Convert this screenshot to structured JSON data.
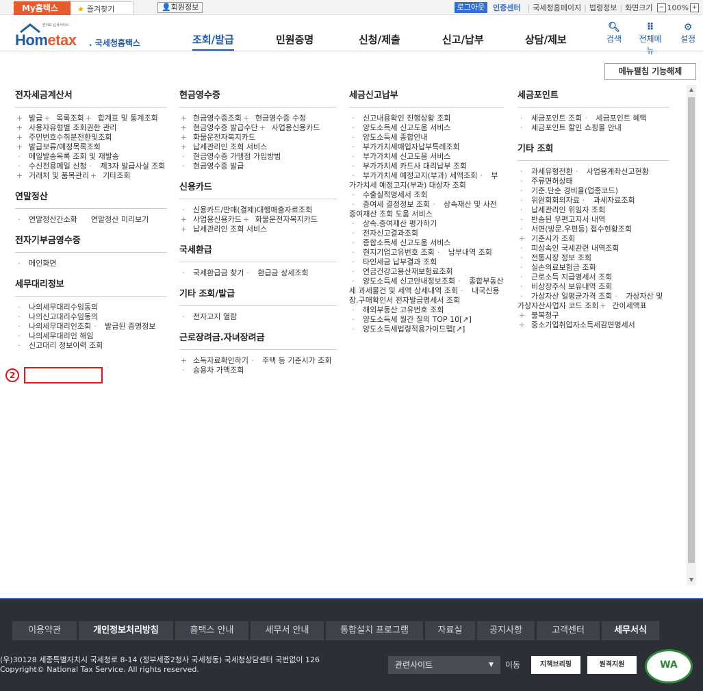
{
  "topbar": {
    "my_tab": "My홈택스",
    "favorites": "즐겨찾기",
    "member_info": "회원정보",
    "logout": "로그아웃",
    "cert_center": "인증센터",
    "nts_home": "국세청홈페이지",
    "law_info": "법령정보",
    "screen_size": "화면크기",
    "zoom": "100%",
    "zoom_minus": "−",
    "zoom_plus": "+"
  },
  "header": {
    "logo_small": "믿어요 납세서비스",
    "logo_hom": "Hom",
    "logo_etax": "etax",
    "logo_kr": ". 국세청홈택스",
    "gnb": [
      "조회/발급",
      "민원증명",
      "신청/제출",
      "신고/납부",
      "상담/제보"
    ],
    "tools": [
      {
        "label": "검색",
        "icon": "search-icon"
      },
      {
        "label": "전체메뉴",
        "icon": "grid-icon"
      },
      {
        "label": "설정",
        "icon": "gear-icon"
      }
    ]
  },
  "unpin_button": "메뉴펼침 기능해제",
  "columns": {
    "col1": {
      "sec1_title": "전자세금계산서",
      "sec1": [
        {
          "b": "+",
          "t": "발급"
        },
        {
          "b": "+",
          "t": "목록조회"
        },
        {
          "b": "+",
          "t": "합계표 및 통계조회"
        },
        {
          "b": "+",
          "t": "사용자유형별 조회권한 관리"
        },
        {
          "b": "+",
          "t": "주민번호수취분전환및조회"
        },
        {
          "b": "+",
          "t": "발급보류/예정목록조회"
        },
        {
          "b": "·",
          "t": "메일발송목록 조회 및 재발송"
        },
        {
          "b": "·",
          "t": "수신전용메일 신청"
        },
        {
          "b": "·",
          "t": "제3자 발급사실 조회"
        },
        {
          "b": "+",
          "t": "거래처 및 품목관리"
        },
        {
          "b": "+",
          "t": "기타조회"
        }
      ],
      "sec2_title": "연말정산",
      "sec2": [
        {
          "b": "·",
          "t": "연말정산간소화"
        },
        {
          "b": "",
          "t": "연말정산 미리보기"
        }
      ],
      "sec3_title": "전자기부금영수증",
      "sec3": [
        {
          "b": "·",
          "t": "메인화면"
        }
      ],
      "sec4_title": "세무대리정보",
      "sec4": [
        {
          "b": "·",
          "t": "나의세무대리수임동의"
        },
        {
          "b": "·",
          "t": "나의신고대리수임동의"
        },
        {
          "b": "·",
          "t": "나의세무대리인조회"
        },
        {
          "b": "·",
          "t": "발급된 증명정보"
        },
        {
          "b": "·",
          "t": "나의세무대리인 해임"
        },
        {
          "b": "·",
          "t": "신고대리 정보이력 조회"
        }
      ],
      "annotation": "2"
    },
    "col2": {
      "sec1_title": "현금영수증",
      "sec1": [
        {
          "b": "+",
          "t": "현금영수증조회"
        },
        {
          "b": "+",
          "t": "현금영수증 수정"
        },
        {
          "b": "+",
          "t": "현금영수증 발급수단"
        },
        {
          "b": "+",
          "t": "사업용신용카드"
        },
        {
          "b": "+",
          "t": "화물운전자복지카드"
        },
        {
          "b": "+",
          "t": "납세관리인 조회 서비스"
        },
        {
          "b": "·",
          "t": "현금영수증 가맹점 가입방법"
        },
        {
          "b": "·",
          "t": "현금영수증 발급"
        }
      ],
      "sec2_title": "신용카드",
      "sec2": [
        {
          "b": "·",
          "t": "신용카드/판매(결제)대행매출자료조회"
        },
        {
          "b": "+",
          "t": "사업용신용카드"
        },
        {
          "b": "+",
          "t": "화물운전자복지카드"
        },
        {
          "b": "+",
          "t": "납세관리인 조회 서비스"
        }
      ],
      "sec3_title": "국세환급",
      "sec3": [
        {
          "b": "·",
          "t": "국세환급금 찾기"
        },
        {
          "b": "·",
          "t": "환급금 상세조회"
        }
      ],
      "sec4_title": "기타 조회/발급",
      "sec4": [
        {
          "b": "·",
          "t": "전자고지 열람"
        }
      ],
      "sec5_title": "근로장려금.자녀장려금",
      "sec5": [
        {
          "b": "+",
          "t": "소득자료확인하기"
        },
        {
          "b": "·",
          "t": "주택 등 기준시가 조회"
        },
        {
          "b": "·",
          "t": "승용차 가액조회"
        }
      ]
    },
    "col3": {
      "sec1_title": "세금신고납부",
      "sec1": [
        {
          "b": "·",
          "t": "신고내용확인 진행상황 조회"
        },
        {
          "b": "·",
          "t": "양도소득세 신고도움 서비스"
        },
        {
          "b": "·",
          "t": "양도소득세 종합안내"
        },
        {
          "b": "·",
          "t": "부가가치세매입자납부특례조회"
        },
        {
          "b": "·",
          "t": "부가가치세 신고도움 서비스"
        },
        {
          "b": "·",
          "t": "부가가치세 카드사 대리납부 조회"
        },
        {
          "b": "·",
          "t": "부가가치세 예정고지(부과) 세액조회"
        },
        {
          "b": "·",
          "t": "부가가치세 예정고지(부과) 대상자 조회",
          "two": true
        },
        {
          "b": "·",
          "t": "수출실적명세서 조회"
        },
        {
          "b": "·",
          "t": "증여세 결정정보 조회"
        },
        {
          "b": "·",
          "t": "상속재산 및 사전증여재산 조회 도움 서비스",
          "two": true
        },
        {
          "b": "·",
          "t": "상속.증여재산 평가하기"
        },
        {
          "b": "·",
          "t": "전자신고결과조회"
        },
        {
          "b": "·",
          "t": "종합소득세 신고도움 서비스"
        },
        {
          "b": "·",
          "t": "현지기업고유번호 조회"
        },
        {
          "b": "·",
          "t": "납부내역 조회"
        },
        {
          "b": "·",
          "t": "타인세금 납부결과 조회"
        },
        {
          "b": "·",
          "t": "연금건강고용산재보험료조회"
        },
        {
          "b": "·",
          "t": "양도소득세 신고안내정보조회"
        },
        {
          "b": "·",
          "t": "종합부동산세 과세물건 및 세액 상세내역 조회",
          "two": true
        },
        {
          "b": "·",
          "t": "내국신용장.구매확인서 전자발급명세서 조회",
          "two": true
        },
        {
          "b": "·",
          "t": "해외부동산 고유번호 조회"
        },
        {
          "b": "·",
          "t": "양도소득세 월간 질의 TOP 10[↗]"
        },
        {
          "b": "·",
          "t": "양도소득세법령적용가이드맵[↗]"
        }
      ]
    },
    "col4": {
      "sec1_title": "세금포인트",
      "sec1": [
        {
          "b": "·",
          "t": "세금포인트 조회"
        },
        {
          "b": "·",
          "t": "세금포인트 혜택"
        },
        {
          "b": "·",
          "t": "세금포인트 할인 쇼핑몰 안내"
        }
      ],
      "sec2_title": "기타 조회",
      "sec2": [
        {
          "b": "·",
          "t": "과세유형전환"
        },
        {
          "b": "·",
          "t": "사업용계좌신고현황"
        },
        {
          "b": "·",
          "t": "주류면허상태"
        },
        {
          "b": "·",
          "t": "기준.단순 경비율(업종코드)"
        },
        {
          "b": "·",
          "t": "위원회회의자료"
        },
        {
          "b": "·",
          "t": "과세자료조회"
        },
        {
          "b": "·",
          "t": "납세관리인 위임자 조회"
        },
        {
          "b": "·",
          "t": "반송된 우편고지서 내역"
        },
        {
          "b": "·",
          "t": "서면(방문,우편등) 접수현황조회"
        },
        {
          "b": "+",
          "t": "기준시가 조회"
        },
        {
          "b": "·",
          "t": "피상속인 국세관련 내역조회"
        },
        {
          "b": "·",
          "t": "전통시장 정보 조회"
        },
        {
          "b": "·",
          "t": "실손의료보험금 조회"
        },
        {
          "b": "·",
          "t": "근로소득 지급명세서 조회"
        },
        {
          "b": "·",
          "t": "비상장주식 보유내역 조회"
        },
        {
          "b": "·",
          "t": "가상자산 일평균가격 조회"
        },
        {
          "b": "·",
          "t": "가상자산 및 가상자산사업자 코드 조회",
          "two": true
        },
        {
          "b": "+",
          "t": "간이세액표"
        },
        {
          "b": "+",
          "t": "불복청구"
        },
        {
          "b": "+",
          "t": "중소기업취업자소득세감면명세서"
        }
      ]
    }
  },
  "footer": {
    "nav": [
      "이용약관",
      "개인정보처리방침",
      "홈택스 안내",
      "세무서 안내",
      "통합설치 프로그램",
      "자료실",
      "공지사항",
      "고객센터",
      "세무서식"
    ],
    "address": "(우)30128 세종특별자치시 국세청로 8-14 (정부세종2청사 국세청동) 국세청상담센터 국번없이 126",
    "copyright": "Copyright© National Tax Service. All rights reserved.",
    "related_select": "관련사이트",
    "go": "이동",
    "btn1": "지책브리핑",
    "btn2": "원격지원",
    "wa_mark": "WA"
  },
  "colors": {
    "primary": "#1f5aa6",
    "accent": "#e8592c",
    "footer_bg": "#2d2f36",
    "highlight": "#e11111"
  }
}
